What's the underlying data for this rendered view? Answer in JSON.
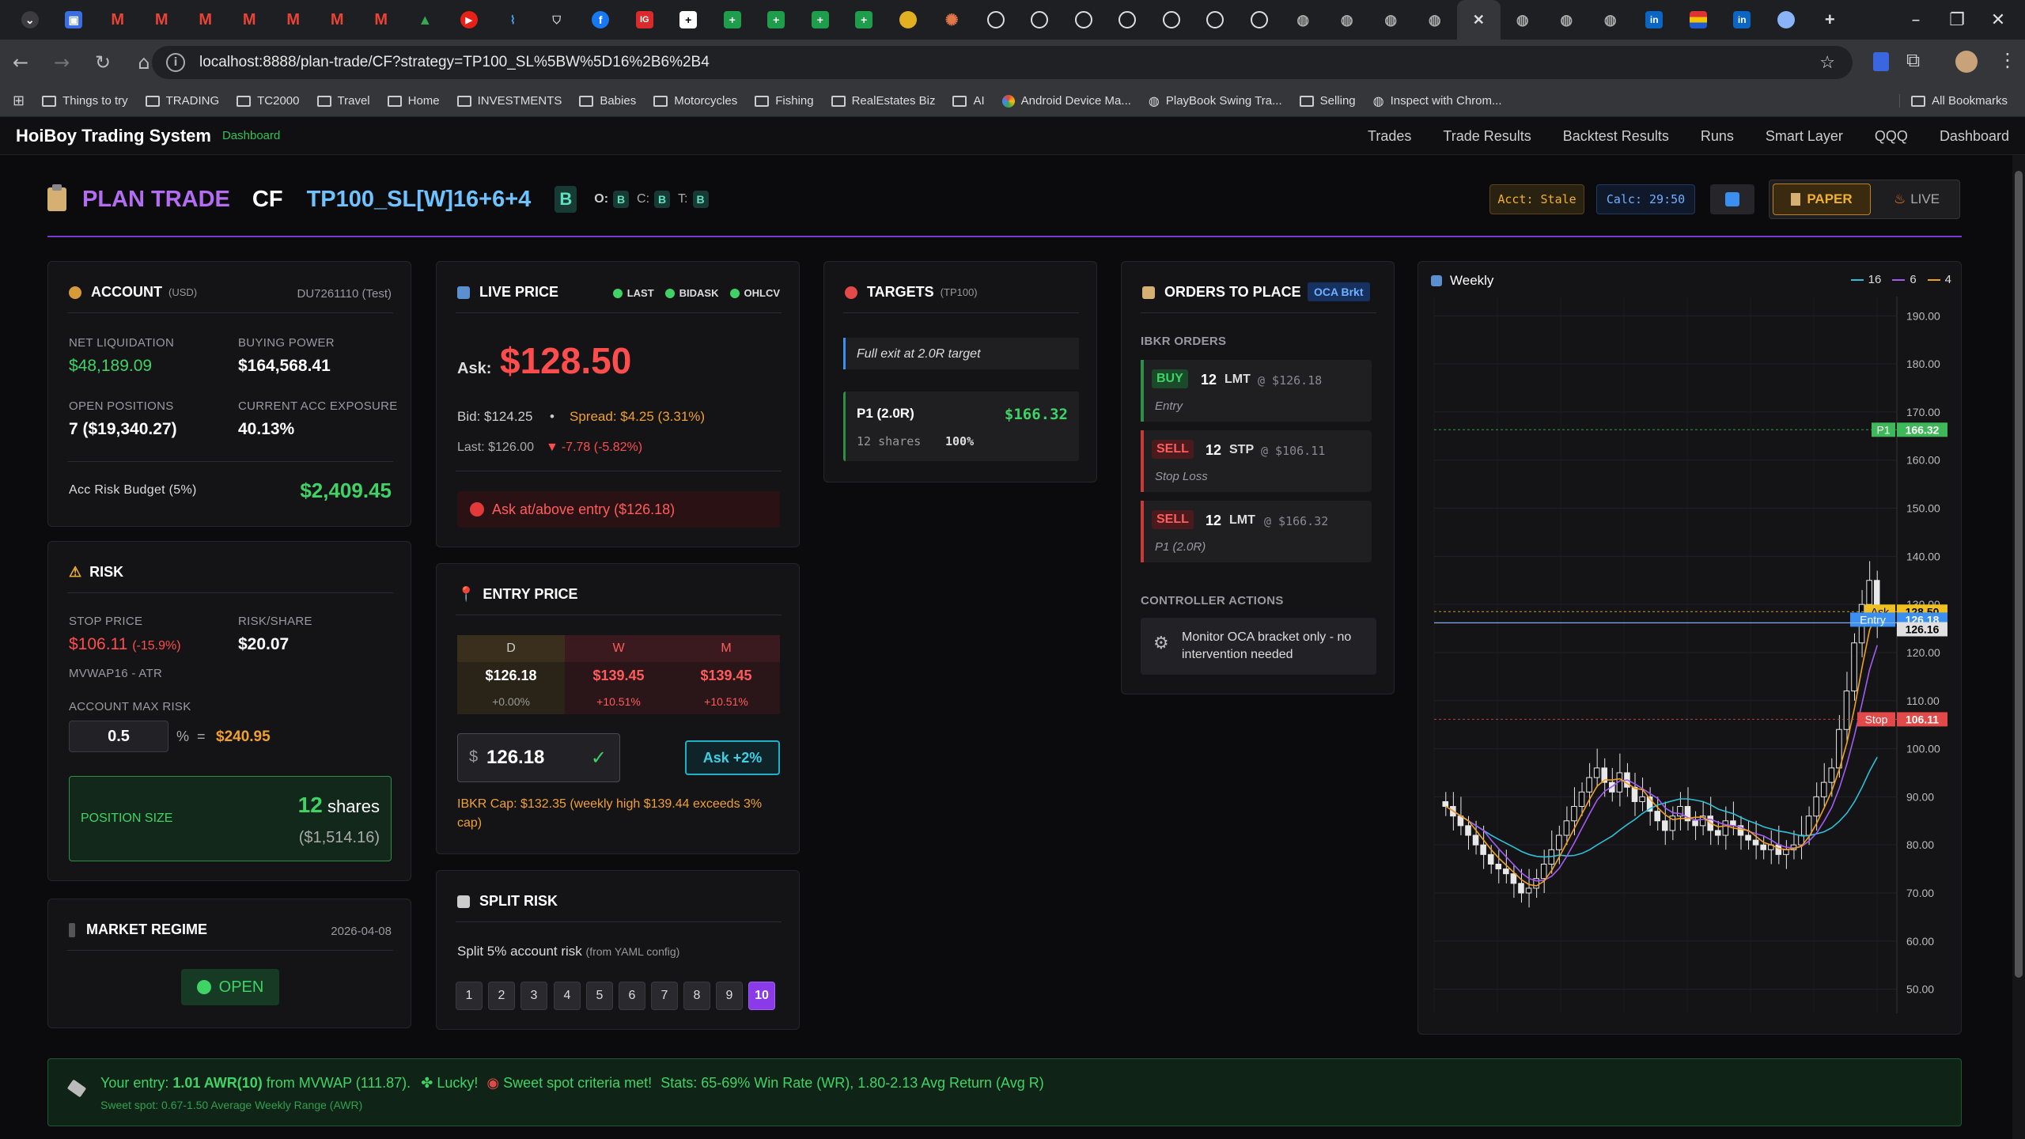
{
  "browser": {
    "url": "localhost:8888/plan-trade/CF?strategy=TP100_SL%5BW%5D16%2B6%2B4",
    "bookmarks": [
      "Things to try",
      "TRADING",
      "TC2000",
      "Travel",
      "Home",
      "INVESTMENTS",
      "Babies",
      "Motorcycles",
      "Fishing",
      "RealEstates Biz",
      "AI",
      "Android Device Ma...",
      "PlayBook Swing Tra...",
      "Selling",
      "Inspect with Chrom...",
      "All Bookmarks"
    ]
  },
  "app": {
    "brand": "HoiBoy Trading System",
    "sub": "Dashboard",
    "nav": [
      "Trades",
      "Trade Results",
      "Backtest Results",
      "Runs",
      "Smart Layer",
      "QQQ",
      "Dashboard"
    ]
  },
  "title": {
    "plan": "PLAN TRADE",
    "symbol": "CF",
    "strategy": "TP100_SL[W]16+6+4",
    "badge": "B",
    "o_label": "O:",
    "o_val": "B",
    "c_label": "C:",
    "c_val": "B",
    "t_label": "T:",
    "t_val": "B",
    "acct_status": "Acct: Stale",
    "calc_status": "Calc: 29:50",
    "paper": "PAPER",
    "live": "LIVE"
  },
  "account": {
    "title": "ACCOUNT",
    "currency": "(USD)",
    "account_id": "DU7261110 (Test)",
    "net_liq_label": "NET LIQUIDATION",
    "net_liq": "$48,189.09",
    "bp_label": "BUYING POWER",
    "bp": "$164,568.41",
    "open_label": "OPEN POSITIONS",
    "open": "7 ($19,340.27)",
    "exp_label": "CURRENT ACC EXPOSURE",
    "exp": "40.13%",
    "budget_label": "Acc Risk Budget (5%)",
    "budget": "$2,409.45"
  },
  "risk": {
    "title": "RISK",
    "stop_label": "STOP PRICE",
    "stop": "$106.11",
    "stop_pct": "(-15.9%)",
    "stop_sub": "MVWAP16 - ATR",
    "rps_label": "RISK/SHARE",
    "rps": "$20.07",
    "max_label": "ACCOUNT MAX RISK",
    "max_input": "0.5",
    "pct": "%",
    "eq": "=",
    "max_amt": "$240.95",
    "pos_label": "POSITION SIZE",
    "pos_qty": "12",
    "pos_unit": "shares",
    "pos_cost": "($1,514.16)"
  },
  "regime": {
    "title": "MARKET REGIME",
    "date": "2026-04-08",
    "status": "OPEN"
  },
  "live": {
    "title": "LIVE PRICE",
    "tags": [
      "LAST",
      "BIDASK",
      "OHLCV"
    ],
    "ask_label": "Ask:",
    "ask": "$128.50",
    "bid": "Bid: $124.25",
    "dot": "•",
    "spread": "Spread: $4.25 (3.31%)",
    "last": "Last: $126.00",
    "change": "-7.78 (-5.82%)",
    "alert": "Ask at/above entry ($126.18)"
  },
  "entry": {
    "title": "ENTRY PRICE",
    "cols": [
      {
        "h": "D",
        "v": "$126.18",
        "p": "+0.00%"
      },
      {
        "h": "W",
        "v": "$139.45",
        "p": "+10.51%"
      },
      {
        "h": "M",
        "v": "$139.45",
        "p": "+10.51%"
      }
    ],
    "dollar": "$",
    "input": "126.18",
    "check": "✓",
    "ask_btn": "Ask +2%",
    "cap": "IBKR Cap: $132.35 (weekly high $139.44 exceeds 3% cap)"
  },
  "split": {
    "title": "SPLIT RISK",
    "text": "Split 5% account risk",
    "sub": "(from YAML config)",
    "buttons": [
      "1",
      "2",
      "3",
      "4",
      "5",
      "6",
      "7",
      "8",
      "9",
      "10"
    ],
    "selected": "10"
  },
  "targets": {
    "title": "TARGETS",
    "tag": "(TP100)",
    "note": "Full exit at 2.0R target",
    "p1": "P1 (2.0R)",
    "p1_price": "$166.32",
    "p1_shares": "12 shares",
    "p1_pct": "100%"
  },
  "orders": {
    "title": "ORDERS TO PLACE",
    "badge": "OCA Brkt",
    "section": "IBKR ORDERS",
    "list": [
      {
        "side": "BUY",
        "qty": "12",
        "type": "LMT",
        "price": "@ $126.18",
        "note": "Entry"
      },
      {
        "side": "SELL",
        "qty": "12",
        "type": "STP",
        "price": "@ $106.11",
        "note": "Stop Loss"
      },
      {
        "side": "SELL",
        "qty": "12",
        "type": "LMT",
        "price": "@ $166.32",
        "note": "P1 (2.0R)"
      }
    ],
    "ctrl_label": "CONTROLLER ACTIONS",
    "ctrl_text": "Monitor OCA bracket only - no intervention needed"
  },
  "chart_data": {
    "type": "candlestick",
    "title": "Weekly",
    "legend": [
      "16",
      "6",
      "4"
    ],
    "colors": {
      "ma16": "#2fc0d9",
      "ma6": "#a35cf0",
      "ma4": "#f0a020",
      "up": "#e8e8e8",
      "down": "#e8e8e8"
    },
    "ylim": [
      45,
      194
    ],
    "yticks": [
      "190.00",
      "180.00",
      "170.00",
      "160.00",
      "150.00",
      "140.00",
      "130.00",
      "120.00",
      "110.00",
      "100.00",
      "90.00",
      "80.00",
      "70.00",
      "60.00",
      "50.00"
    ],
    "levels": [
      {
        "label": "P1",
        "value": 166.32,
        "text": "166.32",
        "color": "#3fb85a"
      },
      {
        "label": "Ask",
        "value": 128.5,
        "text": "128.50",
        "color": "#f0c020"
      },
      {
        "label": "Entry",
        "value": 126.18,
        "text": "126.18",
        "color": "#3a8ff0"
      },
      {
        "label": "",
        "value": 126.16,
        "text": "126.16",
        "color": "#e0e0e0"
      },
      {
        "label": "Stop",
        "value": 106.11,
        "text": "106.11",
        "color": "#e24a4a"
      }
    ],
    "closes": [
      88,
      86,
      84,
      82,
      80,
      78,
      76,
      75,
      74,
      72,
      70,
      71,
      73,
      76,
      79,
      82,
      85,
      88,
      91,
      94,
      96,
      93,
      91,
      95,
      92,
      89,
      90,
      87,
      85,
      83,
      86,
      88,
      85,
      84,
      86,
      83,
      82,
      85,
      84,
      82,
      81,
      80,
      79,
      80,
      78,
      79,
      80,
      82,
      86,
      90,
      93,
      96,
      104,
      112,
      122,
      130,
      135,
      126
    ]
  },
  "banner": {
    "l1a": "Your entry:",
    "l1b": "1.01 AWR(10)",
    "l1c": "from MVWAP (111.87).",
    "lucky": "Lucky!",
    "sweet": "Sweet spot criteria met!",
    "stats": "Stats: 65-69% Win Rate (WR), 1.80-2.13 Avg Return (Avg R)",
    "l2": "Sweet spot: 0.67-1.50 Average Weekly Range (AWR)"
  }
}
